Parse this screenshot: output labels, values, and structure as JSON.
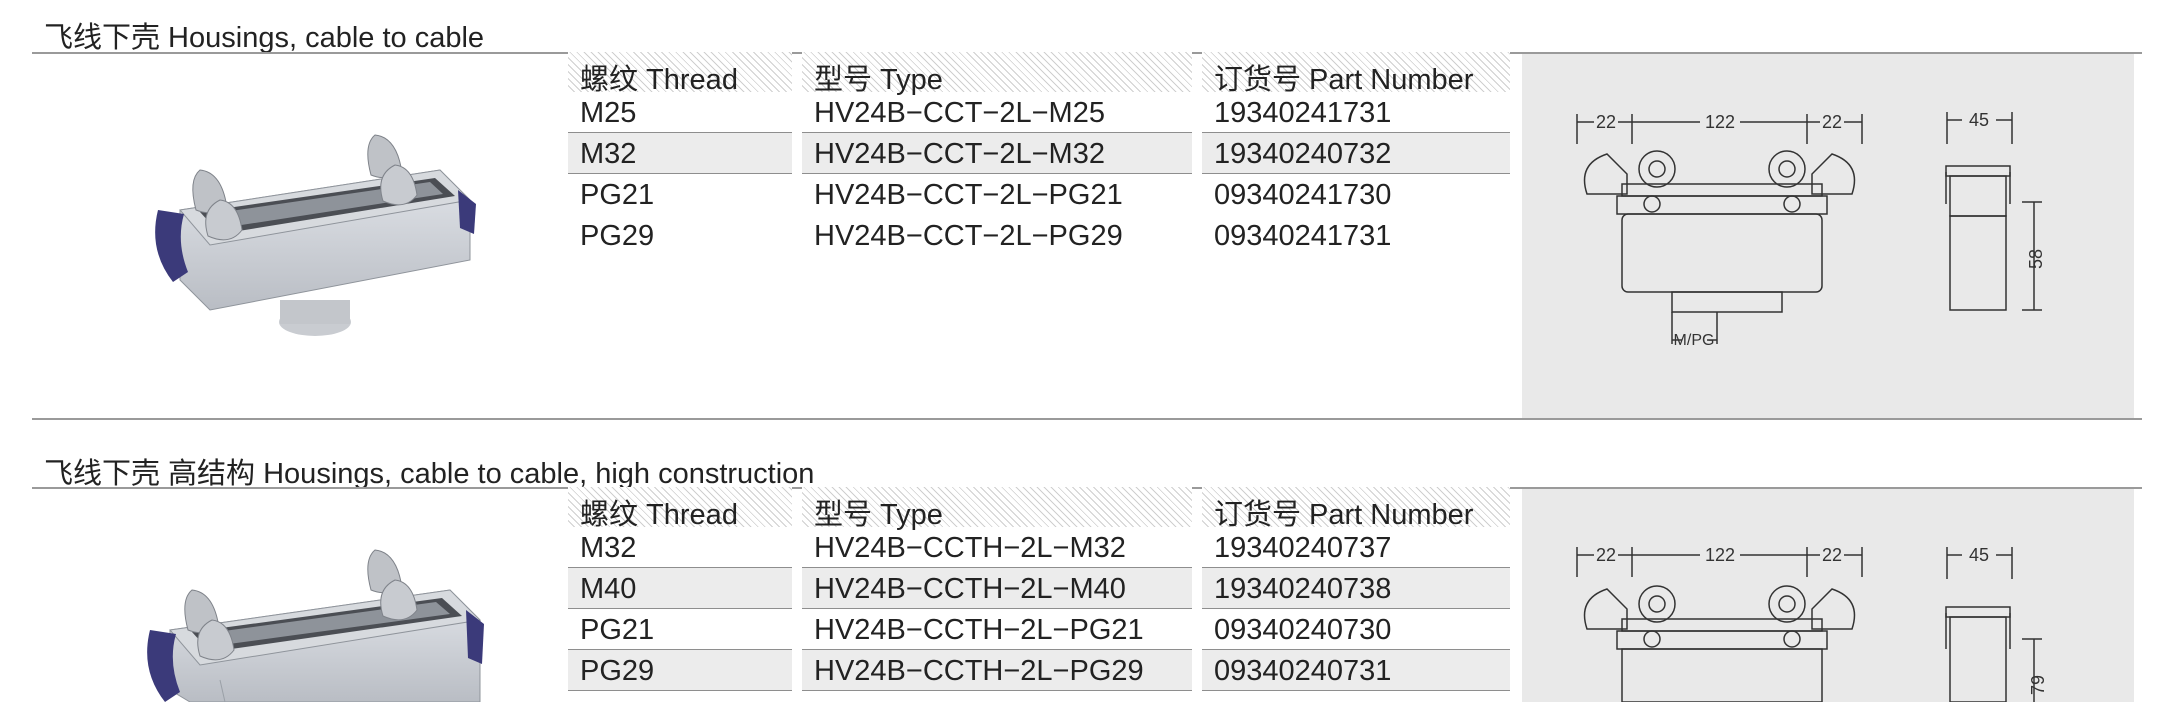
{
  "sections": [
    {
      "title": "飞线下壳 Housings, cable to cable",
      "headers": {
        "thread": "螺纹 Thread",
        "type": "型号 Type",
        "part": "订货号 Part Number"
      },
      "rows": [
        {
          "thread": "M25",
          "type": "HV24B−CCT−2L−M25",
          "part": "19340241731"
        },
        {
          "thread": "M32",
          "type": "HV24B−CCT−2L−M32",
          "part": "19340240732"
        },
        {
          "thread": "PG21",
          "type": "HV24B−CCT−2L−PG21",
          "part": "09340241730"
        },
        {
          "thread": "PG29",
          "type": "HV24B−CCT−2L−PG29",
          "part": "09340241731"
        }
      ],
      "dimensions": {
        "left": "22",
        "middle": "122",
        "right": "22",
        "depth": "45",
        "height": "58",
        "thread_label": "M/PG"
      }
    },
    {
      "title": "飞线下壳 高结构 Housings, cable to cable, high construction",
      "headers": {
        "thread": "螺纹 Thread",
        "type": "型号 Type",
        "part": "订货号 Part Number"
      },
      "rows": [
        {
          "thread": "M32",
          "type": "HV24B−CCTH−2L−M32",
          "part": "19340240737"
        },
        {
          "thread": "M40",
          "type": "HV24B−CCTH−2L−M40",
          "part": "19340240738"
        },
        {
          "thread": "PG21",
          "type": "HV24B−CCTH−2L−PG21",
          "part": "09340240730"
        },
        {
          "thread": "PG29",
          "type": "HV24B−CCTH−2L−PG29",
          "part": "09340240731"
        }
      ],
      "dimensions": {
        "left": "22",
        "middle": "122",
        "right": "22",
        "depth": "45",
        "height": "79"
      }
    }
  ]
}
